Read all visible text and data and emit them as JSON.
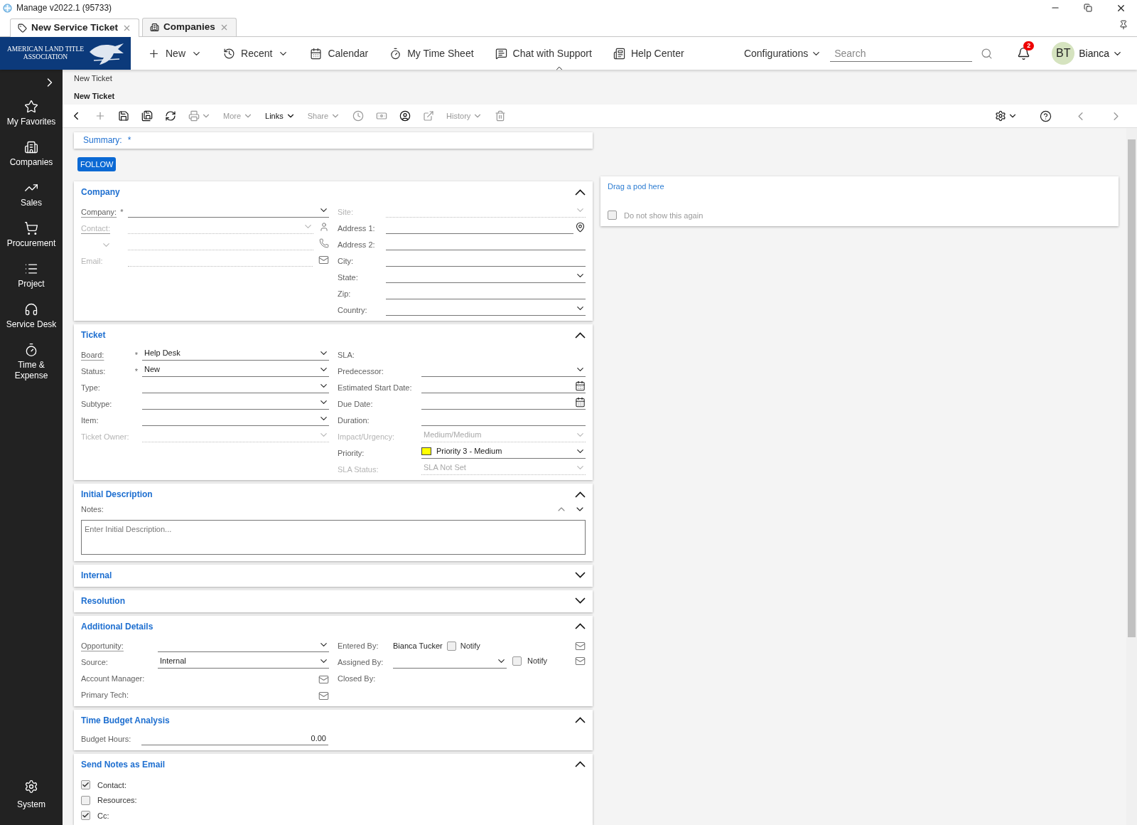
{
  "window": {
    "title": "Manage v2022.1 (95733)"
  },
  "tabs": [
    {
      "label": "New Service Ticket",
      "selected": true
    },
    {
      "label": "Companies",
      "selected": false
    }
  ],
  "logo": {
    "lines": [
      "AMERICAN LAND TITLE",
      "ASSOCIATION"
    ]
  },
  "nav": [
    {
      "label": "New",
      "dropdown": true
    },
    {
      "label": "Recent",
      "dropdown": true
    },
    {
      "label": "Calendar",
      "dropdown": false
    },
    {
      "label": "My Time Sheet",
      "dropdown": false
    },
    {
      "label": "Chat with Support",
      "dropdown": false
    },
    {
      "label": "Help Center",
      "dropdown": false
    }
  ],
  "configurations": "Configurations",
  "search": {
    "placeholder": "Search"
  },
  "notifications": {
    "count": "2"
  },
  "user": {
    "initials": "BT",
    "name": "Bianca"
  },
  "sidebar": {
    "items": [
      {
        "label": "My Favorites"
      },
      {
        "label": "Companies"
      },
      {
        "label": "Sales"
      },
      {
        "label": "Procurement"
      },
      {
        "label": "Project"
      },
      {
        "label": "Service Desk"
      },
      {
        "label": "Time &\nExpense"
      }
    ],
    "bottom": "System"
  },
  "breadcrumb": "New Ticket",
  "page_title": "New Ticket",
  "toolbar": [
    {
      "kind": "back",
      "disabled": false
    },
    {
      "kind": "add",
      "disabled": true
    },
    {
      "kind": "save",
      "disabled": false
    },
    {
      "kind": "save-close",
      "disabled": false
    },
    {
      "kind": "refresh",
      "disabled": false
    },
    {
      "kind": "print",
      "disabled": true
    },
    {
      "kind": "menu",
      "label": "More",
      "disabled": true
    },
    {
      "kind": "menu",
      "label": "Links",
      "disabled": false
    },
    {
      "kind": "menu",
      "label": "Share",
      "disabled": true
    },
    {
      "kind": "timer",
      "disabled": true
    },
    {
      "kind": "money",
      "disabled": true
    },
    {
      "kind": "person",
      "disabled": false
    },
    {
      "kind": "open",
      "disabled": true
    },
    {
      "kind": "menu",
      "label": "History",
      "disabled": true
    },
    {
      "kind": "delete",
      "disabled": true
    }
  ],
  "summary": {
    "label": "Summary:",
    "required_mark": "*"
  },
  "follow_button": "FOLLOW",
  "sections": [
    {
      "title": "Company",
      "expanded": true,
      "kind": "fields",
      "left": [
        {
          "label": "Company:",
          "required_mark": "*",
          "kind": "select",
          "linked": true,
          "disabled": false
        },
        {
          "label": "Contact:",
          "kind": "contact",
          "linked": true,
          "disabled": true
        },
        {
          "kind": "phone-type",
          "linked": false,
          "disabled": true
        },
        {
          "label": "Email:",
          "kind": "email",
          "linked": false,
          "disabled": true
        }
      ],
      "right": [
        {
          "label": "Site:",
          "kind": "select",
          "linked": false,
          "disabled": true
        },
        {
          "label": "Address 1:",
          "kind": "address",
          "linked": false,
          "disabled": false
        },
        {
          "label": "Address 2:",
          "kind": "text",
          "linked": false,
          "disabled": false
        },
        {
          "label": "City:",
          "kind": "text",
          "linked": false,
          "disabled": false
        },
        {
          "label": "State:",
          "kind": "select",
          "linked": false,
          "disabled": false
        },
        {
          "label": "Zip:",
          "kind": "text",
          "linked": false,
          "disabled": false
        },
        {
          "label": "Country:",
          "kind": "select",
          "linked": false,
          "disabled": false
        }
      ]
    },
    {
      "title": "Ticket",
      "expanded": true,
      "kind": "fields",
      "left": [
        {
          "label": "Board:",
          "required_mark": "*",
          "kind": "select",
          "value": "Help Desk",
          "linked": true,
          "disabled": false
        },
        {
          "label": "Status:",
          "required_mark": "*",
          "kind": "select",
          "value": "New",
          "linked": false,
          "disabled": false
        },
        {
          "label": "Type:",
          "kind": "select",
          "linked": false,
          "disabled": false
        },
        {
          "label": "Subtype:",
          "kind": "select",
          "linked": false,
          "disabled": false
        },
        {
          "label": "Item:",
          "kind": "select",
          "linked": false,
          "disabled": false
        },
        {
          "label": "Ticket Owner:",
          "kind": "select",
          "linked": false,
          "disabled": true
        }
      ],
      "right": [
        {
          "label": "SLA:",
          "kind": "readonly",
          "linked": false,
          "disabled": false
        },
        {
          "label": "Predecessor:",
          "kind": "select",
          "linked": false,
          "disabled": false
        },
        {
          "label": "Estimated Start Date:",
          "kind": "date",
          "linked": false,
          "disabled": false
        },
        {
          "label": "Due Date:",
          "kind": "date",
          "linked": false,
          "disabled": false
        },
        {
          "label": "Duration:",
          "kind": "text",
          "linked": false,
          "disabled": false
        },
        {
          "label": "Impact/Urgency:",
          "kind": "select",
          "value": "Medium/Medium",
          "linked": false,
          "disabled": true
        },
        {
          "label": "Priority:",
          "kind": "select",
          "value": "Priority 3 - Medium",
          "color": "#ffff00",
          "linked": false,
          "disabled": false
        },
        {
          "label": "SLA Status:",
          "kind": "select",
          "value": "SLA Not Set",
          "linked": false,
          "disabled": true
        }
      ]
    },
    {
      "title": "Initial Description",
      "expanded": true,
      "kind": "notes",
      "label": "Notes:",
      "placeholder": "Enter Initial Description..."
    },
    {
      "title": "Internal",
      "expanded": false,
      "kind": "fields"
    },
    {
      "title": "Resolution",
      "expanded": false,
      "kind": "fields"
    },
    {
      "title": "Additional Details",
      "expanded": true,
      "kind": "fields",
      "left": [
        {
          "label": "Opportunity:",
          "kind": "select",
          "linked": true,
          "disabled": false
        },
        {
          "label": "Source:",
          "kind": "select",
          "value": "Internal",
          "linked": false,
          "disabled": false
        },
        {
          "label": "Account Manager:",
          "kind": "mail-only",
          "linked": false,
          "disabled": false
        },
        {
          "label": "Primary Tech:",
          "kind": "mail-only",
          "linked": false,
          "disabled": false
        }
      ],
      "right": [
        {
          "label": "Entered By:",
          "kind": "user",
          "value": "Bianca Tucker",
          "notify": "Notify",
          "notify_checked": false,
          "linked": false,
          "disabled": false
        },
        {
          "label": "Assigned By:",
          "kind": "assign",
          "notify": "Notify",
          "notify_checked": false,
          "linked": false,
          "disabled": false
        },
        {
          "label": "Closed By:",
          "kind": "readonly",
          "linked": false,
          "disabled": false
        }
      ]
    },
    {
      "title": "Time Budget Analysis",
      "expanded": true,
      "kind": "budget",
      "label": "Budget Hours:",
      "value": "0.00"
    },
    {
      "title": "Send Notes as Email",
      "expanded": true,
      "kind": "email",
      "options": [
        {
          "label": "Contact:",
          "checked": true
        },
        {
          "label": "Resources:",
          "checked": false
        },
        {
          "label": "Cc:",
          "checked": true
        }
      ]
    }
  ],
  "pod": {
    "link": "Drag a pod here",
    "checkbox": {
      "label": "Do not show this again",
      "checked": false
    }
  }
}
